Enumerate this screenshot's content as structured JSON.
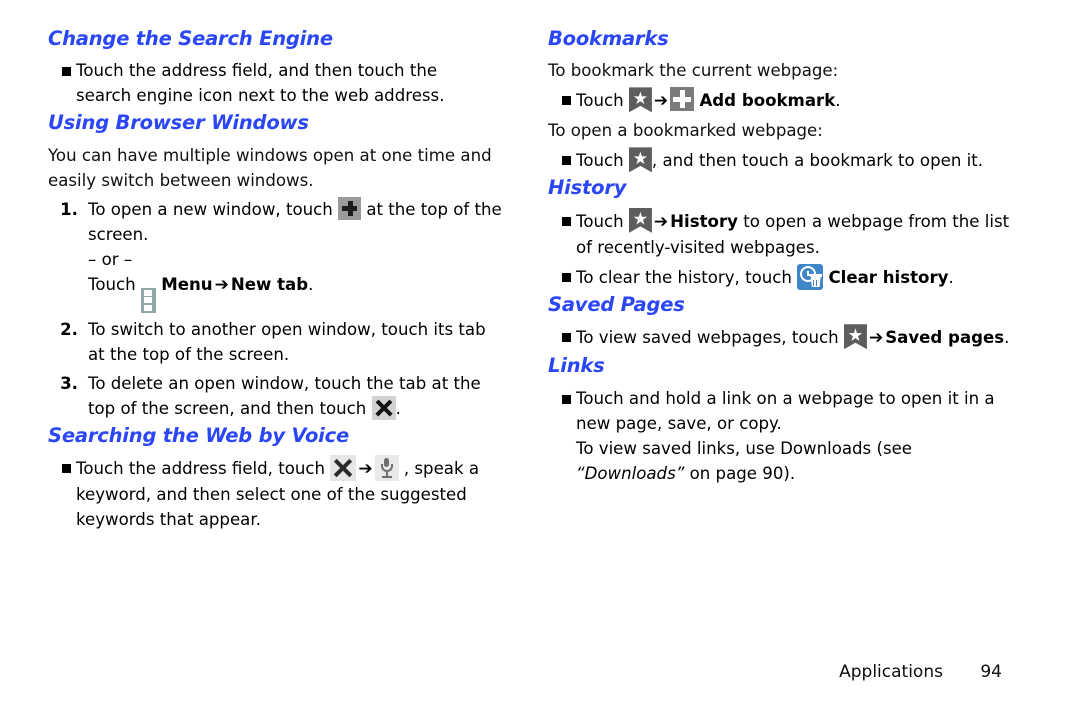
{
  "document": {
    "footer": {
      "chapter": "Applications",
      "page_number": "94"
    }
  },
  "left_column": {
    "sections": [
      {
        "heading": "Change the Search Engine",
        "bullet_text": "Touch the address field, and then touch the search engine icon next to the web address."
      },
      {
        "heading": "Using Browser Windows",
        "intro": "You can have multiple windows open at one time and easily switch between windows.",
        "steps": [
          {
            "number": "1.",
            "text_before_icon": "To open a new window, touch",
            "icon": "plus-icon",
            "text_after_icon": "at the top of the screen.",
            "or_text": "– or –",
            "alt_touch": "Touch",
            "alt_icon": "menu-icon",
            "alt_bold_1": "Menu",
            "alt_arrow": "➔",
            "alt_bold_2": "New tab",
            "alt_period": "."
          },
          {
            "number": "2.",
            "text": "To switch to another open window, touch its tab at the top of the screen."
          },
          {
            "number": "3.",
            "text_before_icon": "To delete an open window, touch the tab at the top of the screen, and then touch",
            "icon": "close-x-icon",
            "text_after_icon": "."
          }
        ]
      },
      {
        "heading": "Searching the Web by Voice",
        "bullet": {
          "text_before_icon": "Touch the address field, touch",
          "icon_1": "close-x-icon",
          "arrow": "➔",
          "icon_2": "microphone-icon",
          "text_after_icon": ", speak a keyword, and then select one of the suggested keywords that appear."
        }
      }
    ]
  },
  "right_column": {
    "sections": [
      {
        "heading": "Bookmarks",
        "intro_1": "To bookmark the current webpage:",
        "bullet_1": {
          "touch": "Touch",
          "icon_1": "bookmark-star-icon",
          "arrow": "➔",
          "icon_2": "add-bookmark-plus-icon",
          "bold_label": "Add bookmark",
          "period": "."
        },
        "intro_2": "To open a bookmarked webpage:",
        "bullet_2": {
          "touch": "Touch",
          "icon_1": "bookmark-star-icon",
          "text_after": ", and then touch a bookmark to open it."
        }
      },
      {
        "heading": "History",
        "bullet_1": {
          "touch": "Touch",
          "icon_1": "bookmark-star-icon",
          "arrow": "➔",
          "bold_label": "History",
          "text_after": "to open a webpage from the list of recently-visited webpages."
        },
        "bullet_2": {
          "text_before_icon": "To clear the history, touch",
          "icon_1": "clear-history-icon",
          "bold_label": "Clear history",
          "period": "."
        }
      },
      {
        "heading": "Saved Pages",
        "bullet_1": {
          "text_before_icon": "To view saved webpages, touch",
          "icon_1": "bookmark-star-icon",
          "arrow": "➔",
          "bold_label": "Saved pages",
          "period": "."
        }
      },
      {
        "heading": "Links",
        "bullet_1": {
          "text": "Touch and hold a link on a webpage to open it in a new page, save, or copy.",
          "sub_text_before": "To view saved links, use Downloads (see",
          "sub_italic": "“Downloads”",
          "sub_text_after": "on page 90)."
        }
      }
    ]
  },
  "colors": {
    "heading_blue": "#2B47F5",
    "body_black": "#101010",
    "icon_gray": "#9a9a9a",
    "menu_teal": "#8fa8a5",
    "clear_history_blue": "#3f86c9"
  }
}
